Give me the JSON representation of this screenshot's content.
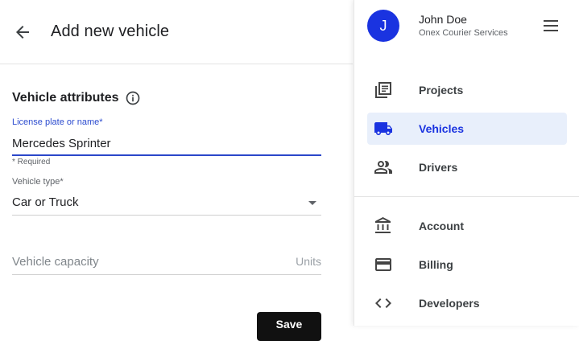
{
  "header": {
    "title": "Add new vehicle"
  },
  "form": {
    "section_title": "Vehicle attributes",
    "license_plate": {
      "label": "License plate or name*",
      "value": "Mercedes Sprinter",
      "helper": "* Required"
    },
    "vehicle_type": {
      "label": "Vehicle type*",
      "value": "Car or Truck"
    },
    "capacity": {
      "placeholder": "Vehicle capacity",
      "suffix": "Units"
    },
    "save_label": "Save"
  },
  "drawer": {
    "user": {
      "initial": "J",
      "name": "John Doe",
      "org": "Onex Courier Services"
    },
    "nav": [
      {
        "label": "Projects",
        "icon": "projects-icon",
        "active": false
      },
      {
        "label": "Vehicles",
        "icon": "truck-icon",
        "active": true
      },
      {
        "label": "Drivers",
        "icon": "people-icon",
        "active": false
      },
      {
        "label": "Account",
        "icon": "bank-icon",
        "active": false
      },
      {
        "label": "Billing",
        "icon": "credit-card-icon",
        "active": false
      },
      {
        "label": "Developers",
        "icon": "code-icon",
        "active": false
      }
    ]
  },
  "colors": {
    "accent": "#1a33e0",
    "active_bg": "#e8effb",
    "save_bg": "#111111"
  }
}
